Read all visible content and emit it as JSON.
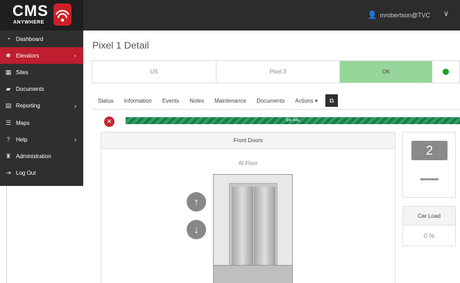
{
  "app": {
    "logo_main": "CMS",
    "logo_sub": "ANYWHERE",
    "brand_color": "#be1e2d"
  },
  "header": {
    "username": "mrobertson@TVC"
  },
  "sidebar": {
    "items": [
      {
        "label": "Dashboard",
        "icon": "dashboard-icon"
      },
      {
        "label": "Elevators",
        "icon": "elevator-icon",
        "active": true
      },
      {
        "label": "Sites",
        "icon": "building-icon"
      },
      {
        "label": "Documents",
        "icon": "folder-icon"
      },
      {
        "label": "Reporting",
        "icon": "report-icon"
      },
      {
        "label": "Maps",
        "icon": "map-icon"
      },
      {
        "label": "Help",
        "icon": "help-icon"
      },
      {
        "label": "Administration",
        "icon": "admin-icon"
      },
      {
        "label": "Log Out",
        "icon": "logout-icon"
      }
    ]
  },
  "page": {
    "title": "Pixel 1 Detail"
  },
  "status": {
    "country": "US",
    "device": "Pixel 3",
    "state": "OK",
    "ok_color": "#97d69a",
    "dot_color": "#1e9f2a"
  },
  "tabs": {
    "status": "Status",
    "information": "Information",
    "events": "Events",
    "notes": "Notes",
    "maintenance": "Maintenance",
    "documents": "Documents",
    "actions": "Actions"
  },
  "progress": {
    "label": "9m 44s",
    "fraction": 1.0
  },
  "doors": {
    "title": "Front Doors",
    "position": "At Floor"
  },
  "floor": {
    "number": "2"
  },
  "car_load": {
    "title": "Car Load",
    "value": "0 %"
  }
}
